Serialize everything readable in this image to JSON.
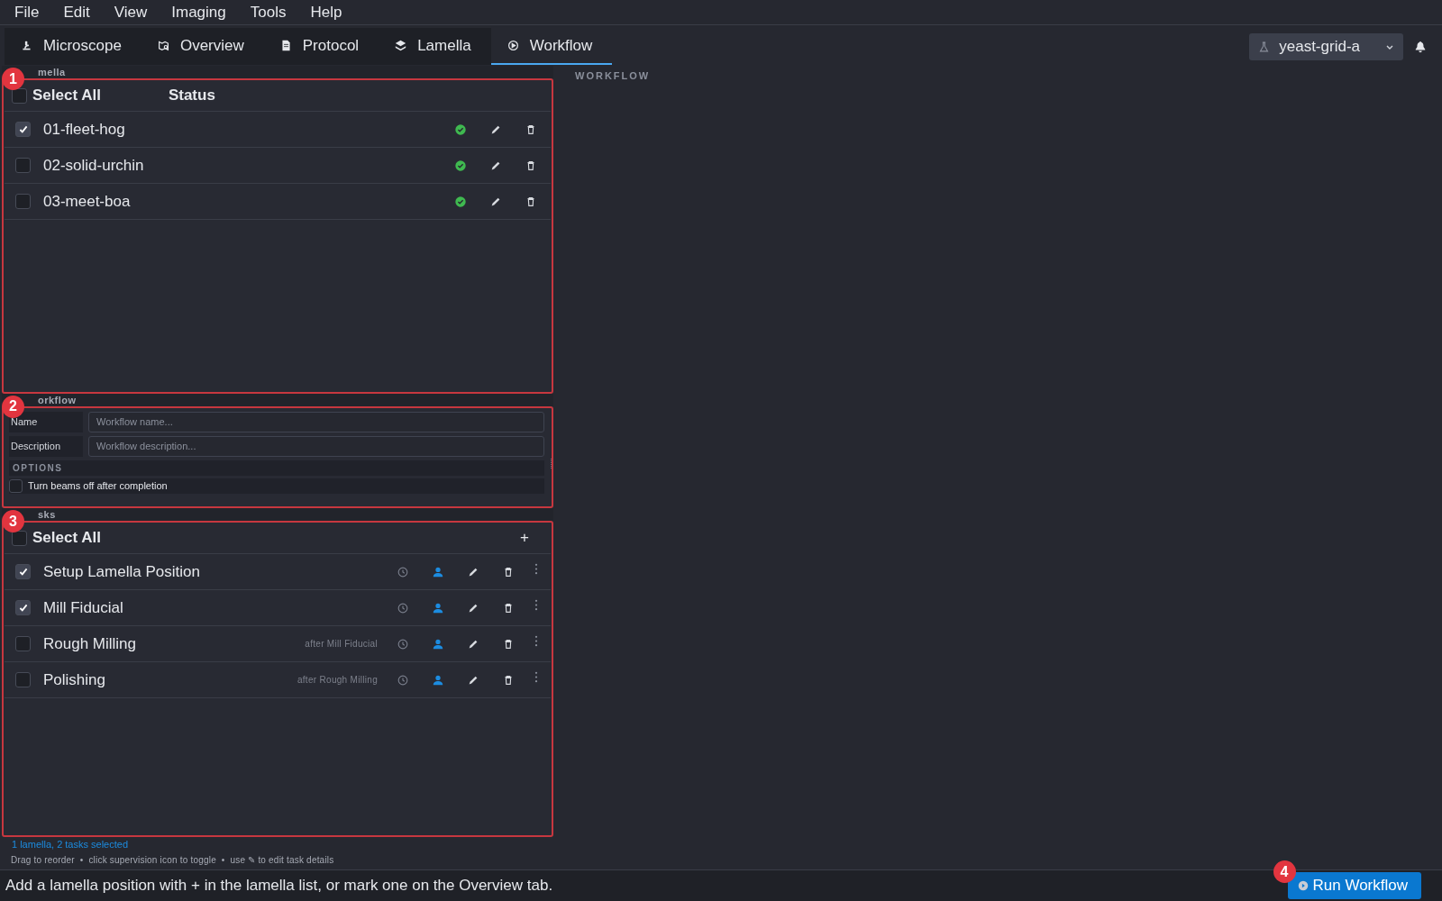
{
  "menu": [
    "File",
    "Edit",
    "View",
    "Imaging",
    "Tools",
    "Help"
  ],
  "tabs": [
    {
      "label": "Microscope",
      "selected": false
    },
    {
      "label": "Overview",
      "selected": false
    },
    {
      "label": "Protocol",
      "selected": false
    },
    {
      "label": "Lamella",
      "selected": false
    },
    {
      "label": "Workflow",
      "selected": true
    }
  ],
  "project_selector": {
    "value": "yeast-grid-a"
  },
  "lamella_section": {
    "label": "mella",
    "select_all": {
      "label": "Select All",
      "checked": false
    },
    "status_header": "Status",
    "rows": [
      {
        "name": "01-fleet-hog",
        "checked": true
      },
      {
        "name": "02-solid-urchin",
        "checked": false
      },
      {
        "name": "03-meet-boa",
        "checked": false
      }
    ]
  },
  "workflow_section": {
    "label": "orkflow",
    "fields": [
      {
        "label": "Name",
        "placeholder": "Workflow name..."
      },
      {
        "label": "Description",
        "placeholder": "Workflow description..."
      }
    ],
    "options_header": "OPTIONS",
    "options": [
      {
        "label": "Turn beams off after completion",
        "checked": false
      }
    ]
  },
  "tasks_section": {
    "label": "sks",
    "select_all": {
      "label": "Select All",
      "checked": false
    },
    "add_button": "+",
    "rows": [
      {
        "name": "Setup Lamella Position",
        "checked": true
      },
      {
        "name": "Mill Fiducial",
        "checked": true
      },
      {
        "name": "Rough Milling",
        "checked": false,
        "dependency": "after Mill Fiducial"
      },
      {
        "name": "Polishing",
        "checked": false,
        "dependency": "after Rough Milling"
      }
    ]
  },
  "selection_summary": "1 lamella, 2 tasks selected",
  "hint": "Drag to reorder  •  click supervision icon to toggle  •  use ✎ to edit task details",
  "right_panel": {
    "label": "WORKFLOW"
  },
  "status_bar": {
    "message": "Add a lamella position with + in the lamella list, or mark one on the Overview tab.",
    "run_button": "Run Workflow"
  },
  "annotations": [
    "1",
    "2",
    "3",
    "4"
  ]
}
